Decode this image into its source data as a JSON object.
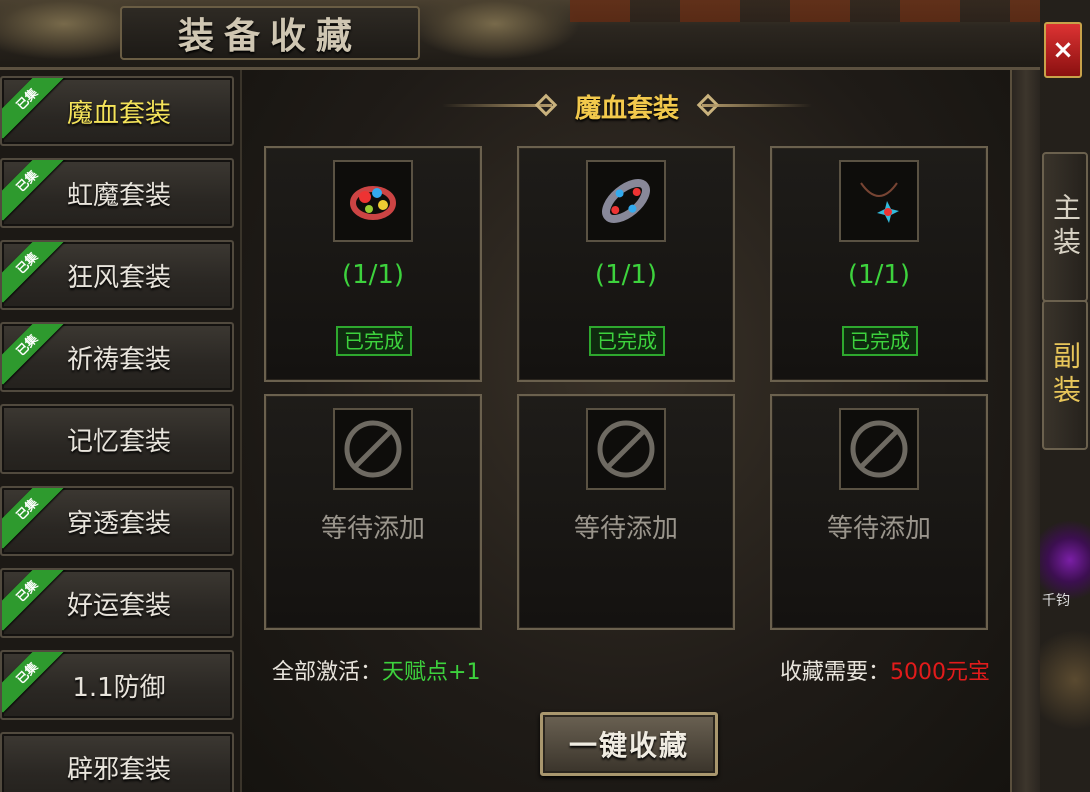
{
  "window": {
    "title": "装备收藏",
    "close_label": "×"
  },
  "sidebar": {
    "items": [
      {
        "label": "魔血套装",
        "collected": true,
        "collected_badge": "已集",
        "active": true
      },
      {
        "label": "虹魔套装",
        "collected": true,
        "collected_badge": "已集",
        "active": false
      },
      {
        "label": "狂风套装",
        "collected": true,
        "collected_badge": "已集",
        "active": false
      },
      {
        "label": "祈祷套装",
        "collected": true,
        "collected_badge": "已集",
        "active": false
      },
      {
        "label": "记忆套装",
        "collected": false,
        "collected_badge": "",
        "active": false
      },
      {
        "label": "穿透套装",
        "collected": true,
        "collected_badge": "已集",
        "active": false
      },
      {
        "label": "好运套装",
        "collected": true,
        "collected_badge": "已集",
        "active": false
      },
      {
        "label": "1.1防御",
        "collected": true,
        "collected_badge": "已集",
        "active": false
      },
      {
        "label": "辟邪套装",
        "collected": false,
        "collected_badge": "",
        "active": false
      }
    ]
  },
  "main": {
    "section_title": "魔血套装",
    "slots": [
      {
        "icon": "bracelet-icon",
        "count": "(1/1)",
        "status": "已完成"
      },
      {
        "icon": "ring-icon",
        "count": "(1/1)",
        "status": "已完成"
      },
      {
        "icon": "necklace-icon",
        "count": "(1/1)",
        "status": "已完成"
      },
      {
        "icon": "empty-slot-icon",
        "wait": "等待添加"
      },
      {
        "icon": "empty-slot-icon",
        "wait": "等待添加"
      },
      {
        "icon": "empty-slot-icon",
        "wait": "等待添加"
      }
    ],
    "footer": {
      "activate_label": "全部激活：",
      "activate_bonus": "天赋点+1",
      "cost_label": "收藏需要：",
      "cost_value": "5000元宝"
    },
    "collect_button": "一键收藏"
  },
  "right_tabs": {
    "main_tab": "主装",
    "vice_tab": "副装"
  },
  "orb_label": "千钧",
  "colors": {
    "active": "#f4e35a",
    "green": "#3dd23d",
    "red": "#e21b1b",
    "gold": "#f2c94c"
  }
}
